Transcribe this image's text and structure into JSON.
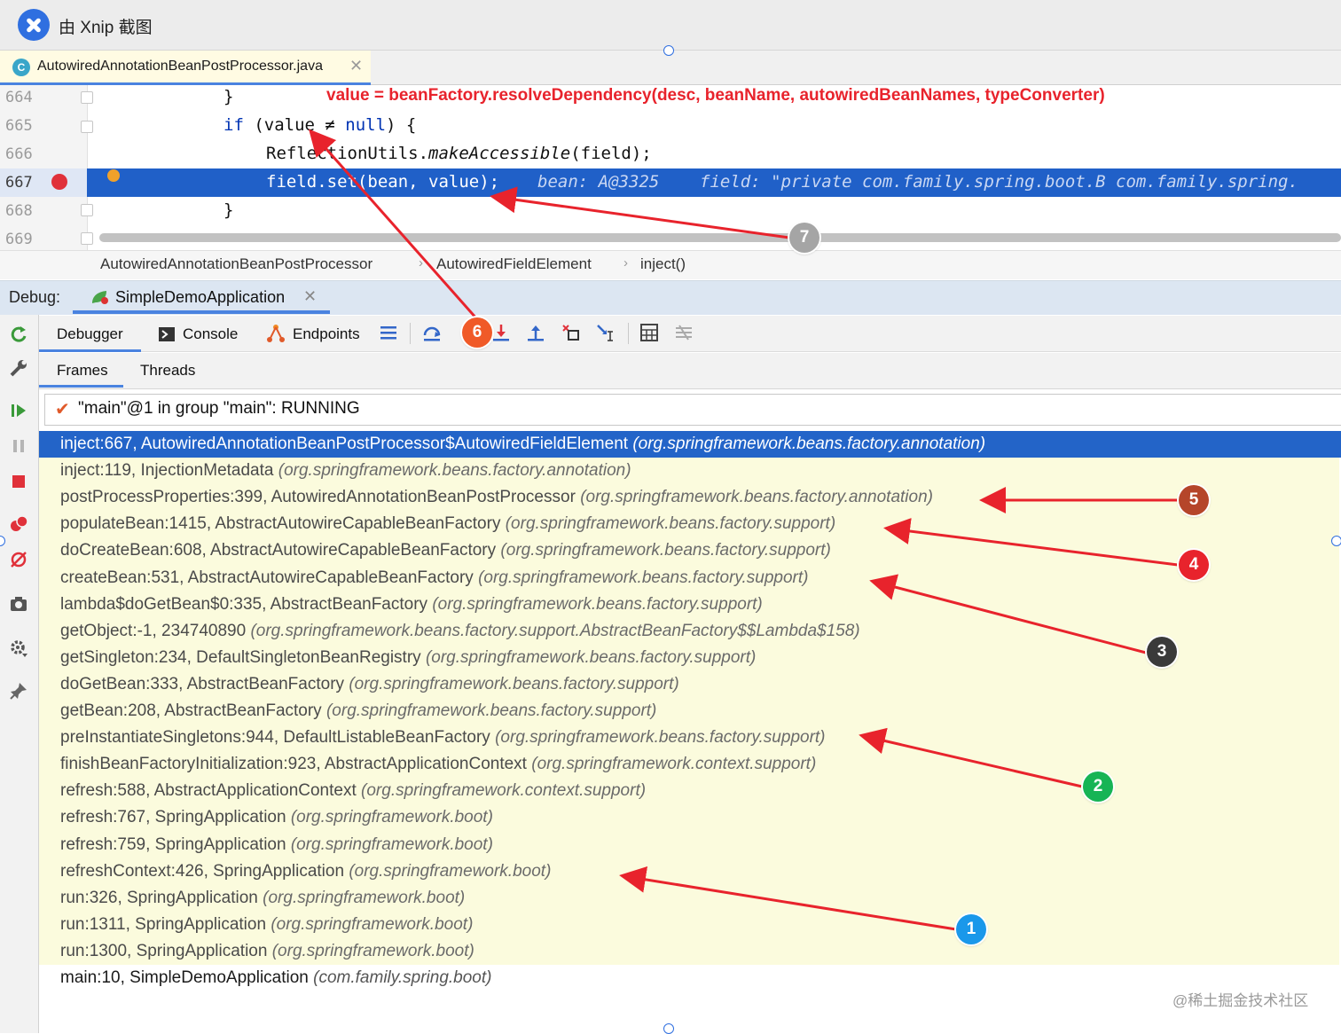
{
  "xnip": {
    "title": "由 Xnip 截图"
  },
  "editor": {
    "tab_label": "AutowiredAnnotationBeanPostProcessor.java",
    "tab_close": "✕",
    "tab_icon_letter": "C",
    "line_numbers": [
      "664",
      "665",
      "666",
      "667",
      "668",
      "669"
    ],
    "lines": {
      "l664": "}",
      "l665_kw": "if",
      "l665_rest": " (value ≠ ",
      "l665_null": "null",
      "l665_end": ") {",
      "l666_a": "ReflectionUtils.",
      "l666_b": "makeAccessible",
      "l666_c": "(field);",
      "l667": "field.set(bean, value);",
      "l667_inline": "bean: A@3325    field: \"private com.family.spring.boot.B com.family.spring.",
      "l668": "}"
    },
    "annotation": "value = beanFactory.resolveDependency(desc, beanName, autowiredBeanNames, typeConverter)",
    "breadcrumb": [
      "AutowiredAnnotationBeanPostProcessor",
      "AutowiredFieldElement",
      "inject()"
    ]
  },
  "debug": {
    "label": "Debug:",
    "run_config": "SimpleDemoApplication",
    "tabs": [
      "Debugger",
      "Console",
      "Endpoints"
    ],
    "subtabs": [
      "Frames",
      "Threads"
    ],
    "thread": "\"main\"@1 in group \"main\": RUNNING",
    "frames": [
      {
        "m": "inject:667, AutowiredAnnotationBeanPostProcessor$AutowiredFieldElement",
        "p": "(org.springframework.beans.factory.annotation)"
      },
      {
        "m": "inject:119, InjectionMetadata",
        "p": "(org.springframework.beans.factory.annotation)"
      },
      {
        "m": "postProcessProperties:399, AutowiredAnnotationBeanPostProcessor",
        "p": "(org.springframework.beans.factory.annotation)"
      },
      {
        "m": "populateBean:1415, AbstractAutowireCapableBeanFactory",
        "p": "(org.springframework.beans.factory.support)"
      },
      {
        "m": "doCreateBean:608, AbstractAutowireCapableBeanFactory",
        "p": "(org.springframework.beans.factory.support)"
      },
      {
        "m": "createBean:531, AbstractAutowireCapableBeanFactory",
        "p": "(org.springframework.beans.factory.support)"
      },
      {
        "m": "lambda$doGetBean$0:335, AbstractBeanFactory",
        "p": "(org.springframework.beans.factory.support)"
      },
      {
        "m": "getObject:-1, 234740890",
        "p": "(org.springframework.beans.factory.support.AbstractBeanFactory$$Lambda$158)"
      },
      {
        "m": "getSingleton:234, DefaultSingletonBeanRegistry",
        "p": "(org.springframework.beans.factory.support)"
      },
      {
        "m": "doGetBean:333, AbstractBeanFactory",
        "p": "(org.springframework.beans.factory.support)"
      },
      {
        "m": "getBean:208, AbstractBeanFactory",
        "p": "(org.springframework.beans.factory.support)"
      },
      {
        "m": "preInstantiateSingletons:944, DefaultListableBeanFactory",
        "p": "(org.springframework.beans.factory.support)"
      },
      {
        "m": "finishBeanFactoryInitialization:923, AbstractApplicationContext",
        "p": "(org.springframework.context.support)"
      },
      {
        "m": "refresh:588, AbstractApplicationContext",
        "p": "(org.springframework.context.support)"
      },
      {
        "m": "refresh:767, SpringApplication",
        "p": "(org.springframework.boot)"
      },
      {
        "m": "refresh:759, SpringApplication",
        "p": "(org.springframework.boot)"
      },
      {
        "m": "refreshContext:426, SpringApplication",
        "p": "(org.springframework.boot)"
      },
      {
        "m": "run:326, SpringApplication",
        "p": "(org.springframework.boot)"
      },
      {
        "m": "run:1311, SpringApplication",
        "p": "(org.springframework.boot)"
      },
      {
        "m": "run:1300, SpringApplication",
        "p": "(org.springframework.boot)"
      },
      {
        "m": "main:10, SimpleDemoApplication",
        "p": "(com.family.spring.boot)"
      }
    ]
  },
  "callouts": [
    {
      "n": "1",
      "color": "#1a98ea"
    },
    {
      "n": "2",
      "color": "#17b455"
    },
    {
      "n": "3",
      "color": "#3a3a3a"
    },
    {
      "n": "4",
      "color": "#e8232c"
    },
    {
      "n": "5",
      "color": "#b5452a"
    },
    {
      "n": "6",
      "color": "#f05a28"
    },
    {
      "n": "7",
      "color": "#a5a5a5"
    }
  ],
  "colors": {
    "arrow": "#e8232c",
    "selection": "#2364c8",
    "frames_bg": "#fbfbdd"
  },
  "watermark": "@稀土掘金技术社区"
}
